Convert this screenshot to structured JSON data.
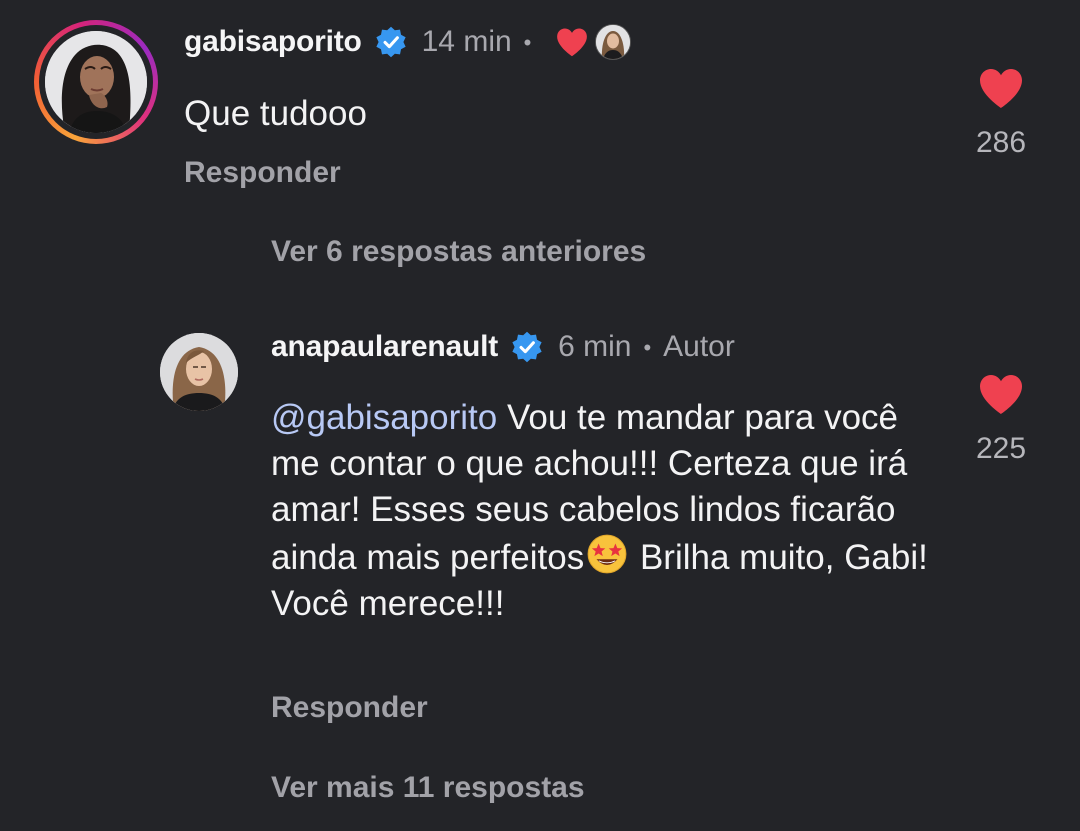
{
  "comment": {
    "username": "gabisaporito",
    "time": "14 min",
    "separator": "•",
    "text": "Que tudooo",
    "reply_label": "Responder",
    "likes": "286",
    "author_liked_icon": "heart-icon",
    "colors": {
      "ring_start": "#f9a43a",
      "ring_end": "#9b2bc0"
    }
  },
  "view_previous_label": "Ver 6 respostas anteriores",
  "reply": {
    "username": "anapaularenault",
    "time": "6 min",
    "separator": "•",
    "badge": "Autor",
    "mention": "@gabisaporito",
    "text_part1": " Vou te mandar para você me contar o que achou!!! Certeza que irá amar! Esses seus cabelos lindos ficarão ainda mais perfeitos",
    "emoji": "star-struck-emoji",
    "text_part2": " Brilha muito, Gabi! Você merece!!!",
    "reply_label": "Responder",
    "likes": "225"
  },
  "view_more_label": "Ver mais 11 respostas",
  "colors": {
    "background": "#232428",
    "like_red": "#ef4150",
    "verified_blue": "#3797f0",
    "mention": "#b8c9f5",
    "secondary_text": "#a8a8ae"
  }
}
